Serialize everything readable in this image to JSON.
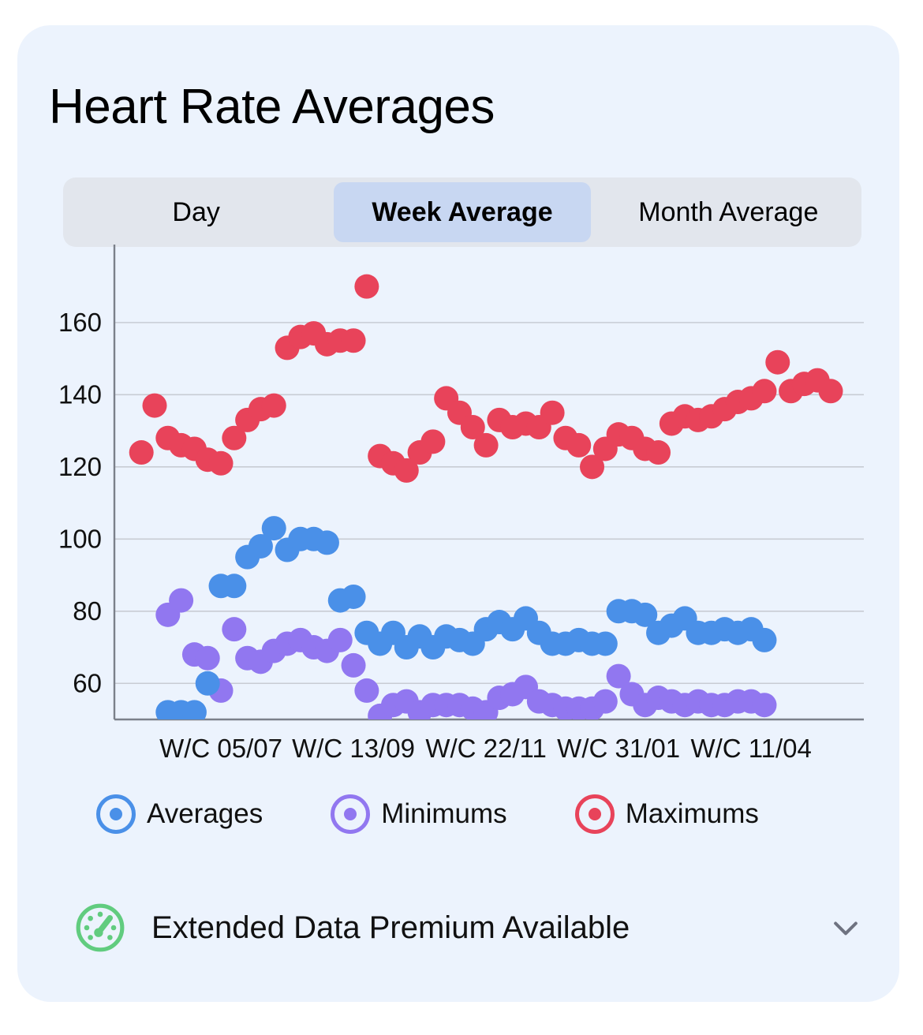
{
  "card": {
    "title": "Heart Rate Averages",
    "background_color": "#ecf3fd"
  },
  "segmented_control": {
    "options": [
      {
        "label": "Day",
        "selected": false
      },
      {
        "label": "Week Average",
        "selected": true
      },
      {
        "label": "Month Average",
        "selected": false
      }
    ],
    "selected_index": 1,
    "selected_background": "#c8d7f2",
    "track_background": "#e2e6ed"
  },
  "legend": [
    {
      "label": "Averages",
      "color": "#4a90e8"
    },
    {
      "label": "Minimums",
      "color": "#9177f0"
    },
    {
      "label": "Maximums",
      "color": "#e8435a"
    }
  ],
  "footer": {
    "icon": "gauge-icon",
    "icon_color": "#61cc7f",
    "label": "Extended Data Premium Available",
    "chevron": "chevron-down-icon",
    "chevron_color": "#6e7280"
  },
  "chart_data": {
    "type": "scatter",
    "title": "Heart Rate Averages",
    "xlabel": "",
    "ylabel": "",
    "ylim": [
      50,
      172
    ],
    "yticks": [
      60,
      80,
      100,
      120,
      140,
      160
    ],
    "xtick_labels": [
      "W/C 05/07",
      "W/C 13/09",
      "W/C 22/11",
      "W/C 31/01",
      "W/C 11/04"
    ],
    "xtick_indices": [
      7,
      17,
      27,
      37,
      47
    ],
    "grid": true,
    "legend_position": "below",
    "n_points": 56,
    "series": [
      {
        "name": "Averages",
        "color": "#4a90e8",
        "values": [
          52,
          52,
          52,
          60,
          87,
          87,
          95,
          98,
          103,
          97,
          100,
          100,
          99,
          83,
          84,
          74,
          71,
          74,
          70,
          73,
          70,
          73,
          72,
          71,
          75,
          77,
          75,
          78,
          74,
          71,
          71,
          72,
          71,
          71,
          80,
          80,
          79,
          74,
          76,
          78,
          74,
          74,
          75,
          74,
          75,
          72
        ]
      },
      {
        "name": "Minimums",
        "color": "#9177f0",
        "values": [
          79,
          83,
          68,
          67,
          58,
          75,
          67,
          66,
          69,
          71,
          72,
          70,
          69,
          72,
          65,
          58,
          51,
          54,
          55,
          52,
          54,
          54,
          54,
          53,
          52,
          56,
          57,
          59,
          55,
          54,
          53,
          53,
          53,
          55,
          62,
          57,
          54,
          56,
          55,
          54,
          55,
          54,
          54,
          55,
          55,
          54
        ]
      },
      {
        "name": "Maximums",
        "color": "#e8435a",
        "values": [
          124,
          137,
          128,
          126,
          125,
          122,
          121,
          128,
          133,
          136,
          137,
          153,
          156,
          157,
          154,
          155,
          155,
          170,
          123,
          121,
          119,
          124,
          127,
          139,
          135,
          131,
          126,
          133,
          131,
          132,
          131,
          135,
          128,
          126,
          120,
          125,
          129,
          128,
          125,
          124,
          132,
          134,
          133,
          134,
          136,
          138,
          139,
          141,
          149,
          141,
          143,
          144,
          141
        ]
      }
    ]
  }
}
